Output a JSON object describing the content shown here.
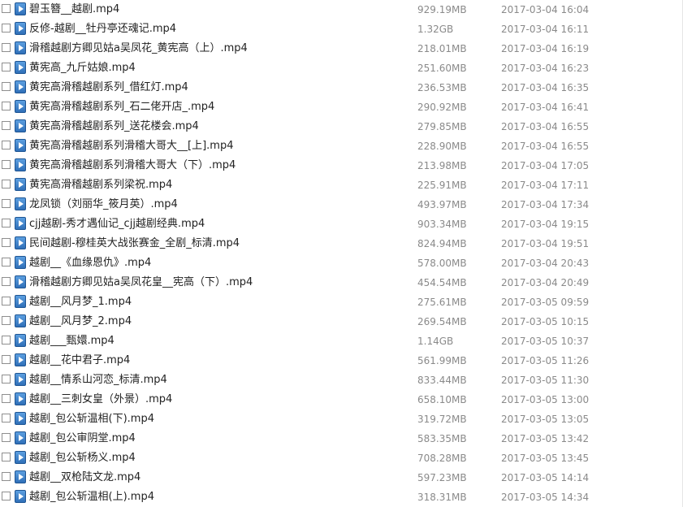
{
  "icon": "video-file-icon",
  "files": [
    {
      "name": "碧玉簪__越剧.mp4",
      "size": "929.19MB",
      "date": "2017-03-04 16:04"
    },
    {
      "name": "反修-越剧__牡丹亭还魂记.mp4",
      "size": "1.32GB",
      "date": "2017-03-04 16:11"
    },
    {
      "name": "滑稽越剧方卿见姑a吴凤花_黄宪高（上）.mp4",
      "size": "218.01MB",
      "date": "2017-03-04 16:19"
    },
    {
      "name": "黄宪高_九斤姑娘.mp4",
      "size": "251.60MB",
      "date": "2017-03-04 16:23"
    },
    {
      "name": "黄宪高滑稽越剧系列_借红灯.mp4",
      "size": "236.53MB",
      "date": "2017-03-04 16:35"
    },
    {
      "name": "黄宪高滑稽越剧系列_石二佬开店_.mp4",
      "size": "290.92MB",
      "date": "2017-03-04 16:41"
    },
    {
      "name": "黄宪高滑稽越剧系列_送花楼会.mp4",
      "size": "279.85MB",
      "date": "2017-03-04 16:55"
    },
    {
      "name": "黄宪高滑稽越剧系列滑稽大哥大__[上].mp4",
      "size": "228.90MB",
      "date": "2017-03-04 16:55"
    },
    {
      "name": "黄宪高滑稽越剧系列滑稽大哥大（下）.mp4",
      "size": "213.98MB",
      "date": "2017-03-04 17:05"
    },
    {
      "name": "黄宪高滑稽越剧系列梁祝.mp4",
      "size": "225.91MB",
      "date": "2017-03-04 17:11"
    },
    {
      "name": "龙凤锁（刘丽华_筱月英）.mp4",
      "size": "493.97MB",
      "date": "2017-03-04 17:34"
    },
    {
      "name": "cjj越剧-秀才遇仙记_cjj越剧经典.mp4",
      "size": "903.34MB",
      "date": "2017-03-04 19:15"
    },
    {
      "name": "民间越剧-穆桂英大战张赛金_全剧_标清.mp4",
      "size": "824.94MB",
      "date": "2017-03-04 19:51"
    },
    {
      "name": "越剧__《血缘恩仇》.mp4",
      "size": "578.00MB",
      "date": "2017-03-04 20:43"
    },
    {
      "name": "滑稽越剧方卿见姑a吴凤花皇__宪高（下）.mp4",
      "size": "454.54MB",
      "date": "2017-03-04 20:49"
    },
    {
      "name": "越剧__风月梦_1.mp4",
      "size": "275.61MB",
      "date": "2017-03-05 09:59"
    },
    {
      "name": "越剧__风月梦_2.mp4",
      "size": "269.54MB",
      "date": "2017-03-05 10:15"
    },
    {
      "name": "越剧___甄嬛.mp4",
      "size": "1.14GB",
      "date": "2017-03-05 10:37"
    },
    {
      "name": "越剧__花中君子.mp4",
      "size": "561.99MB",
      "date": "2017-03-05 11:26"
    },
    {
      "name": "越剧__情系山河恋_标清.mp4",
      "size": "833.44MB",
      "date": "2017-03-05 11:30"
    },
    {
      "name": "越剧__三刺女皇（外景）.mp4",
      "size": "658.10MB",
      "date": "2017-03-05 13:00"
    },
    {
      "name": "越剧_包公斩温相(下).mp4",
      "size": "319.72MB",
      "date": "2017-03-05 13:05"
    },
    {
      "name": "越剧_包公审阴堂.mp4",
      "size": "583.35MB",
      "date": "2017-03-05 13:42"
    },
    {
      "name": "越剧_包公斩杨义.mp4",
      "size": "708.28MB",
      "date": "2017-03-05 13:45"
    },
    {
      "name": "越剧__双枪陆文龙.mp4",
      "size": "597.23MB",
      "date": "2017-03-05 14:14"
    },
    {
      "name": "越剧_包公斩温相(上).mp4",
      "size": "318.31MB",
      "date": "2017-03-05 14:34"
    }
  ]
}
